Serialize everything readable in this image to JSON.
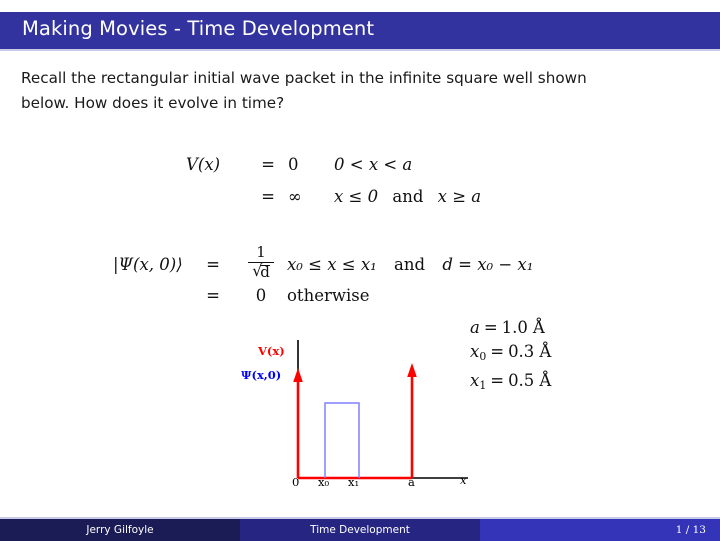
{
  "slide": {
    "title": "Making Movies - Time Development",
    "intro": {
      "line1": "Recall the rectangular initial wave packet in the infinite square well shown",
      "line2": "below. How does it evolve in time?"
    }
  },
  "equations": {
    "potential": {
      "lhs": "V(x)",
      "rows": [
        {
          "eq": "=",
          "value": "0",
          "condition_pre": "0 < x < a",
          "condition_post": ""
        },
        {
          "eq": "=",
          "value": "∞",
          "condition_pre": "x ≤ 0",
          "conjunction": "and",
          "condition_post": "x ≥ a"
        }
      ]
    },
    "wavefunction": {
      "lhs": "|Ψ(x, 0)⟩",
      "row1": {
        "eq": "=",
        "numerator": "1",
        "denominator_radicand": "d",
        "sqrt_glyph": "√",
        "condition": "x₀ ≤ x ≤ x₁",
        "conjunction": "and",
        "definition": "d = x₀ − x₁"
      },
      "row2": {
        "eq": "=",
        "value": "0",
        "condition": "otherwise"
      }
    }
  },
  "parameters": [
    {
      "symbol": "a",
      "subscript": "",
      "value": "1.0",
      "unit": "Å"
    },
    {
      "symbol": "x",
      "subscript": "0",
      "value": "0.3",
      "unit": "Å"
    },
    {
      "symbol": "x",
      "subscript": "1",
      "value": "0.5",
      "unit": "Å"
    }
  ],
  "figure": {
    "labels": {
      "potential_curve": "V(x)",
      "wavefunction_curve": "Ψ(x,0)",
      "origin": "0",
      "x0": "x₀",
      "x1": "x₁",
      "a": "a",
      "x_axis": "x"
    },
    "colors": {
      "potential": "#ff0000",
      "wavefunction": "#8080ff",
      "axis": "#000000"
    }
  },
  "footer": {
    "author": "Jerry Gilfoyle",
    "section": "Time Development",
    "page": "1 / 13"
  },
  "theme": {
    "title_bar": "#3333a0",
    "rule": "#c9c9e8",
    "footer_author_bg": "#1b1b55",
    "footer_section_bg": "#262682",
    "footer_page_bg": "#3434b8"
  }
}
